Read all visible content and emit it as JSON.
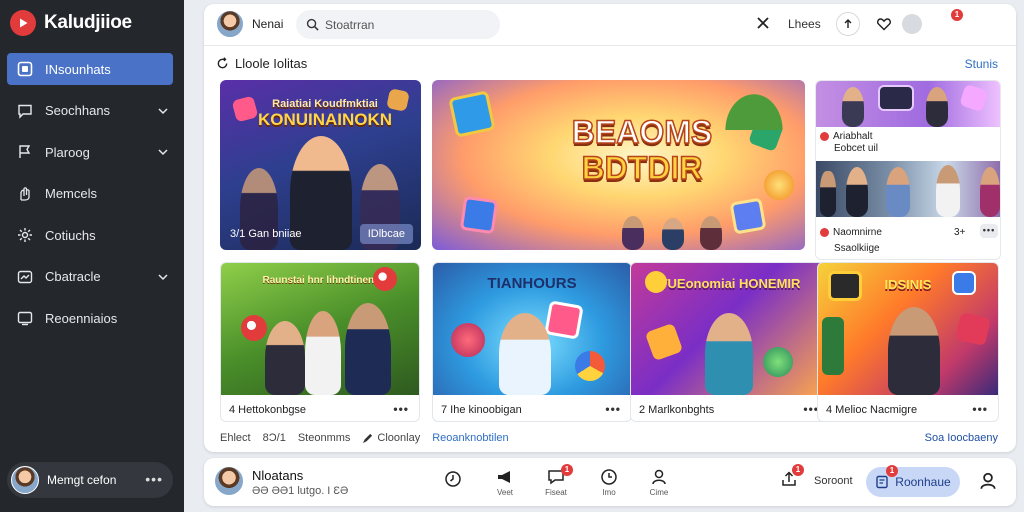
{
  "app": {
    "name": "Kaludjiioe"
  },
  "sidebar": {
    "items": [
      {
        "label": "INsounhats",
        "icon": "play-square-icon",
        "active": true
      },
      {
        "label": "Seochhans",
        "icon": "chat-icon",
        "chevron": true
      },
      {
        "label": "Plaroog",
        "icon": "flag-icon",
        "chevron": true
      },
      {
        "label": "Memcels",
        "icon": "hand-icon"
      },
      {
        "label": "Cotiuchs",
        "icon": "gear-icon"
      },
      {
        "label": "Cbatracle",
        "icon": "chart-icon",
        "chevron": true
      },
      {
        "label": "Reoenniaios",
        "icon": "tv-icon"
      }
    ],
    "user": {
      "name": "Memgt cefon",
      "more": "•••"
    }
  },
  "topbar": {
    "user": "Nenai",
    "search_placeholder": "Stoatrran",
    "label": "Lhees",
    "badge": "1"
  },
  "section": {
    "title": "Lloole Iolitas",
    "link": "Stunis"
  },
  "hero": {
    "card1": {
      "title_small": "Raiatiai Koudfmktiai",
      "title": "KONUINAINOKN",
      "caption": "3/1 Gan bniiae",
      "pill": "IDlbcae"
    },
    "card2": {
      "title_line1": "BEAOMS",
      "title_line2": "BDTDIR"
    },
    "card3": {
      "row1_title": "Ariabhalt",
      "row1_sub": "Eobcet uil",
      "row2_title": "Naomnirne",
      "row2_sub": "Ssaolkiige",
      "row2_count": "3+"
    }
  },
  "games": [
    {
      "title": "Raunstai hnr lihndtinent",
      "caption": "4  Hettokonbgse"
    },
    {
      "title": "TIANHOURS",
      "caption": "7  Ihe kinoobigan"
    },
    {
      "title": "TUEonomiai HONEMIR",
      "caption": "2  Marlkonbghts"
    },
    {
      "title": "IDSINIS",
      "caption": "4  Melioc Nacmigre"
    }
  ],
  "tabs": {
    "items": [
      "Ehlect",
      "8Ɔ/1",
      "Steonmms",
      "Cloonlay"
    ],
    "active": "Reoanknobtilen",
    "right": "Soa Ioocbaeny"
  },
  "bottom": {
    "title": "Nloatans",
    "sub": "ƏƏ ƏƏ1 lutgo. I ƐƏ",
    "icons": [
      {
        "name": "clock-icon",
        "label": "",
        "badge": ""
      },
      {
        "name": "megaphone-icon",
        "label": "Veet",
        "badge": ""
      },
      {
        "name": "chat-bubble-icon",
        "label": "Fiseat",
        "badge": "1"
      },
      {
        "name": "timer-icon",
        "label": "Imo",
        "badge": ""
      },
      {
        "name": "person-icon",
        "label": "Cime",
        "badge": ""
      }
    ],
    "share_badge": "1",
    "sort": "Soroont",
    "primary": "Roonhaue",
    "primary_badge": "1"
  },
  "colors": {
    "accent": "#4a72c6",
    "sidebar": "#24272c",
    "brand_red": "#e23b3b",
    "link": "#2f6fc4"
  }
}
